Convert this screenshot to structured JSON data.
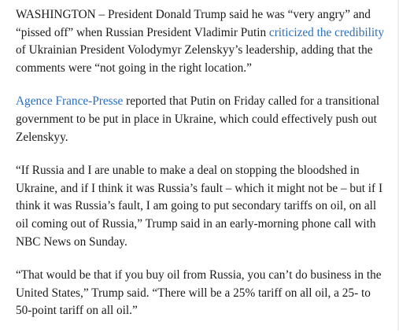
{
  "article": {
    "p1": {
      "before_link": "WASHINGTON – President Donald Trump said he was “very angry” and “pissed off” when Russian President Vladimir Putin ",
      "link": "criticized the credibility",
      "after_link": " of Ukrainian President Volodymyr Zelenskyy’s leadership, adding that the comments were “not going in the right location.”"
    },
    "p2": {
      "link": "Agence France-Presse",
      "after_link": " reported that Putin on Friday called for a transitional government to be put in place in Ukraine, which could effectively push out Zelenskyy."
    },
    "p3": {
      "text": "“If Russia and I are unable to make a deal on stopping the bloodshed in Ukraine, and if I think it was Russia’s fault – which it might not be – but if I think it was Russia’s fault, I am going to put secondary tariffs on oil, on all oil coming out of Russia,” Trump said in an early-morning phone call with NBC News on Sunday."
    },
    "p4": {
      "text": "“That would be that if you buy oil from Russia, you can’t do business in the United States,” Trump said. “There will be a 25% tariff on all oil, a 25- to 50-point tariff on all oil.”"
    },
    "colors": {
      "text": "#1a1a1a",
      "link": "#2a6ebd",
      "background": "#ffffff"
    }
  }
}
